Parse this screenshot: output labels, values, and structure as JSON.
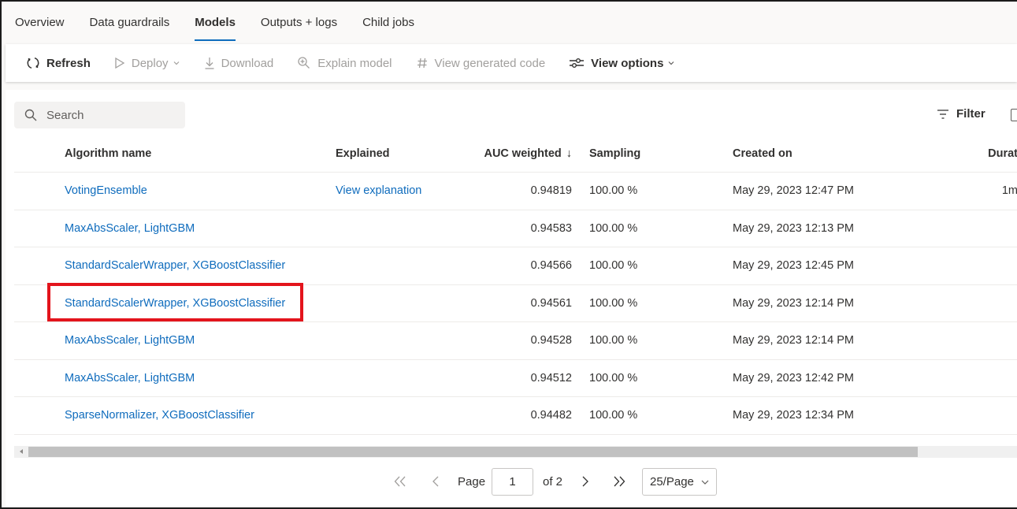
{
  "tabs": [
    "Overview",
    "Data guardrails",
    "Models",
    "Outputs + logs",
    "Child jobs"
  ],
  "active_tab": "Models",
  "toolbar": {
    "refresh": "Refresh",
    "deploy": "Deploy",
    "download": "Download",
    "explain": "Explain model",
    "view_code": "View generated code",
    "view_options": "View options"
  },
  "search": {
    "placeholder": "Search"
  },
  "filter_label": "Filter",
  "table": {
    "headers": {
      "algorithm": "Algorithm name",
      "explained": "Explained",
      "auc": "AUC weighted",
      "sort_arrow": "↓",
      "sampling": "Sampling",
      "created": "Created on",
      "duration": "Durat"
    },
    "rows": [
      {
        "algorithm": "VotingEnsemble",
        "explained": "View explanation",
        "auc": "0.94819",
        "sampling": "100.00 %",
        "created": "May 29, 2023 12:47 PM",
        "duration": "1m"
      },
      {
        "algorithm": "MaxAbsScaler, LightGBM",
        "explained": "",
        "auc": "0.94583",
        "sampling": "100.00 %",
        "created": "May 29, 2023 12:13 PM",
        "duration": ""
      },
      {
        "algorithm": "StandardScalerWrapper, XGBoostClassifier",
        "explained": "",
        "auc": "0.94566",
        "sampling": "100.00 %",
        "created": "May 29, 2023 12:45 PM",
        "duration": ""
      },
      {
        "algorithm": "StandardScalerWrapper, XGBoostClassifier",
        "explained": "",
        "auc": "0.94561",
        "sampling": "100.00 %",
        "created": "May 29, 2023 12:14 PM",
        "duration": ""
      },
      {
        "algorithm": "MaxAbsScaler, LightGBM",
        "explained": "",
        "auc": "0.94528",
        "sampling": "100.00 %",
        "created": "May 29, 2023 12:14 PM",
        "duration": ""
      },
      {
        "algorithm": "MaxAbsScaler, LightGBM",
        "explained": "",
        "auc": "0.94512",
        "sampling": "100.00 %",
        "created": "May 29, 2023 12:42 PM",
        "duration": ""
      },
      {
        "algorithm": "SparseNormalizer, XGBoostClassifier",
        "explained": "",
        "auc": "0.94482",
        "sampling": "100.00 %",
        "created": "May 29, 2023 12:34 PM",
        "duration": ""
      }
    ]
  },
  "pagination": {
    "page_label": "Page",
    "current_page": "1",
    "of_label": "of 2",
    "per_page": "25/Page"
  },
  "colors": {
    "accent": "#0f6cbd",
    "highlight": "#e3141c"
  }
}
